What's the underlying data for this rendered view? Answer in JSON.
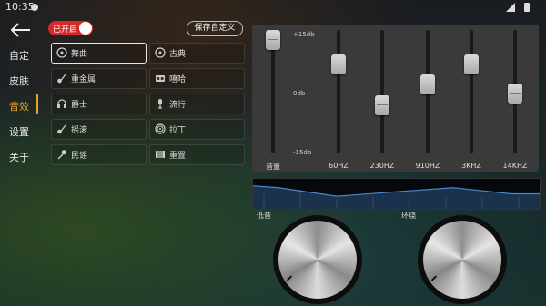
{
  "status_bar": {
    "time": "10:35"
  },
  "nav": {
    "items": [
      {
        "label": "自定"
      },
      {
        "label": "皮肤"
      },
      {
        "label": "音效",
        "active": true
      },
      {
        "label": "设置"
      },
      {
        "label": "关于"
      }
    ]
  },
  "toolbar": {
    "toggle_label": "已开启",
    "toggle_on": true,
    "save_label": "保存自定义"
  },
  "presets": [
    {
      "label": "舞曲",
      "icon": "disc-icon",
      "selected": true
    },
    {
      "label": "古典",
      "icon": "disc-icon"
    },
    {
      "label": "重金属",
      "icon": "guitar-icon"
    },
    {
      "label": "嘻哈",
      "icon": "boombox-icon"
    },
    {
      "label": "爵士",
      "icon": "headphones-icon"
    },
    {
      "label": "流行",
      "icon": "microphone-icon"
    },
    {
      "label": "摇滚",
      "icon": "guitar-icon"
    },
    {
      "label": "拉丁",
      "icon": "drum-icon"
    },
    {
      "label": "民谣",
      "icon": "microphone-icon"
    },
    {
      "label": "重置",
      "icon": "piano-icon"
    }
  ],
  "equalizer": {
    "scale": {
      "top": "+15db",
      "mid": "0db",
      "bottom": "-15db"
    },
    "bands": [
      {
        "label": "音量",
        "level": 1.0
      },
      {
        "label": "60HZ",
        "level": 0.76
      },
      {
        "label": "230HZ",
        "level": 0.37
      },
      {
        "label": "910HZ",
        "level": 0.57
      },
      {
        "label": "3KHZ",
        "level": 0.76
      },
      {
        "label": "14KHZ",
        "level": 0.48
      }
    ]
  },
  "knobs": {
    "bass_label": "低音",
    "surround_label": "环绕"
  }
}
